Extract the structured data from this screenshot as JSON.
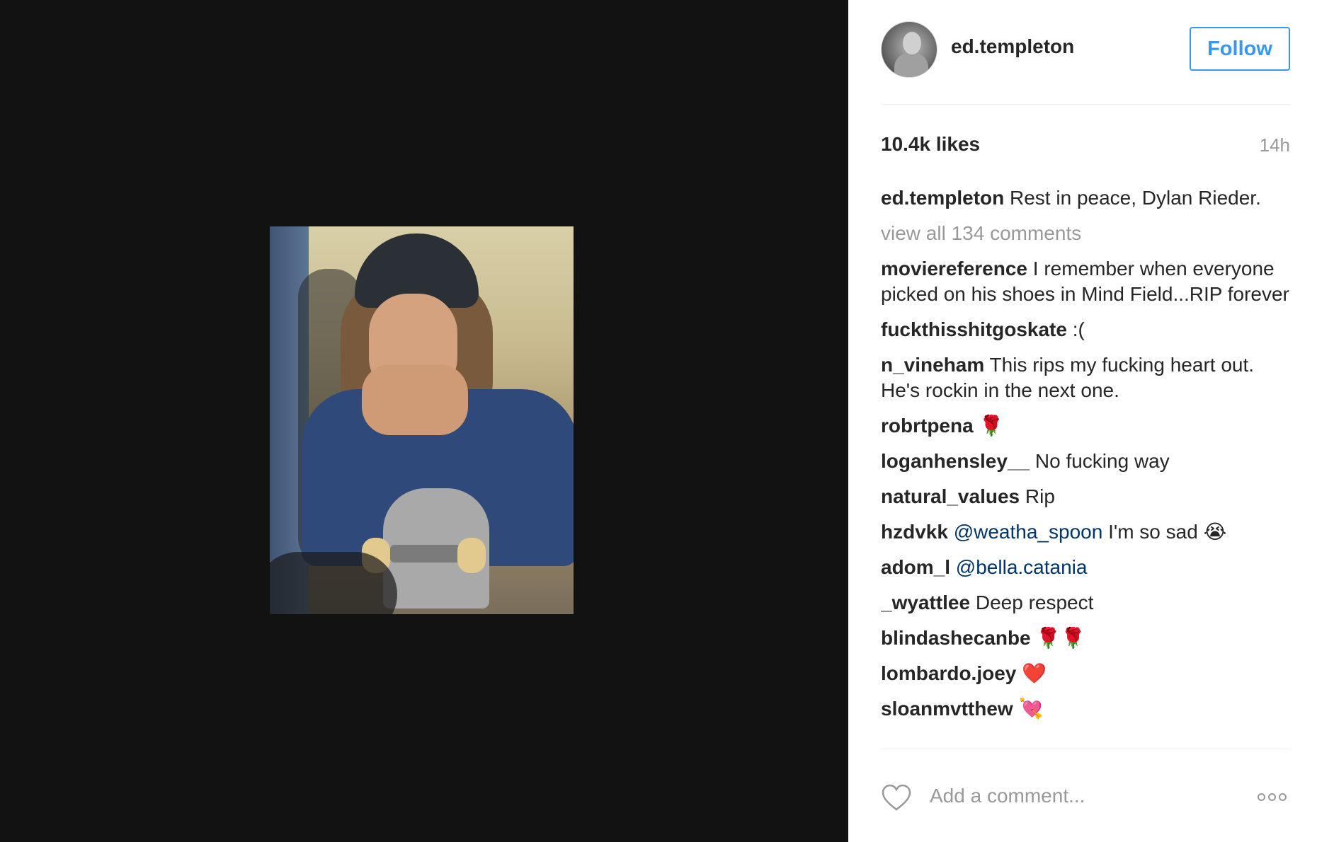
{
  "post": {
    "username": "ed.templeton",
    "follow_label": "Follow",
    "likes": "10.4k likes",
    "time": "14h",
    "caption_user": "ed.templeton",
    "caption_text": " Rest in peace, Dylan Rieder.",
    "view_all": "view all 134 comments"
  },
  "comments": [
    {
      "user": "moviereference",
      "text": " I remember when everyone picked on his shoes in Mind Field...RIP forever"
    },
    {
      "user": "fuckthisshitgoskate",
      "text": " :("
    },
    {
      "user": "n_vineham",
      "text": " This rips my fucking heart out. He's rockin in the next one."
    },
    {
      "user": "robrtpena",
      "text": " 🌹"
    },
    {
      "user": "loganhensley__",
      "text": " No fucking way"
    },
    {
      "user": "natural_values",
      "text": " Rip"
    },
    {
      "user": "hzdvkk",
      "mention": " @weatha_spoon",
      "text": " I'm so sad 😭"
    },
    {
      "user": "adom_l",
      "mention": " @bella.catania",
      "text": ""
    },
    {
      "user": "_wyattlee",
      "text": " Deep respect"
    },
    {
      "user": "blindashecanbe",
      "text": " 🌹🌹"
    },
    {
      "user": "lombardo.joey",
      "text": " ❤️"
    },
    {
      "user": "sloanmvtthew",
      "text": " 💘"
    }
  ],
  "footer": {
    "add_comment_placeholder": "Add a comment...",
    "heart_icon": "heart-outline-icon",
    "more_icon": "more-options-icon"
  },
  "colors": {
    "accent": "#3897f0",
    "mention": "#003569",
    "muted": "#999999",
    "media_bg": "#121212"
  }
}
